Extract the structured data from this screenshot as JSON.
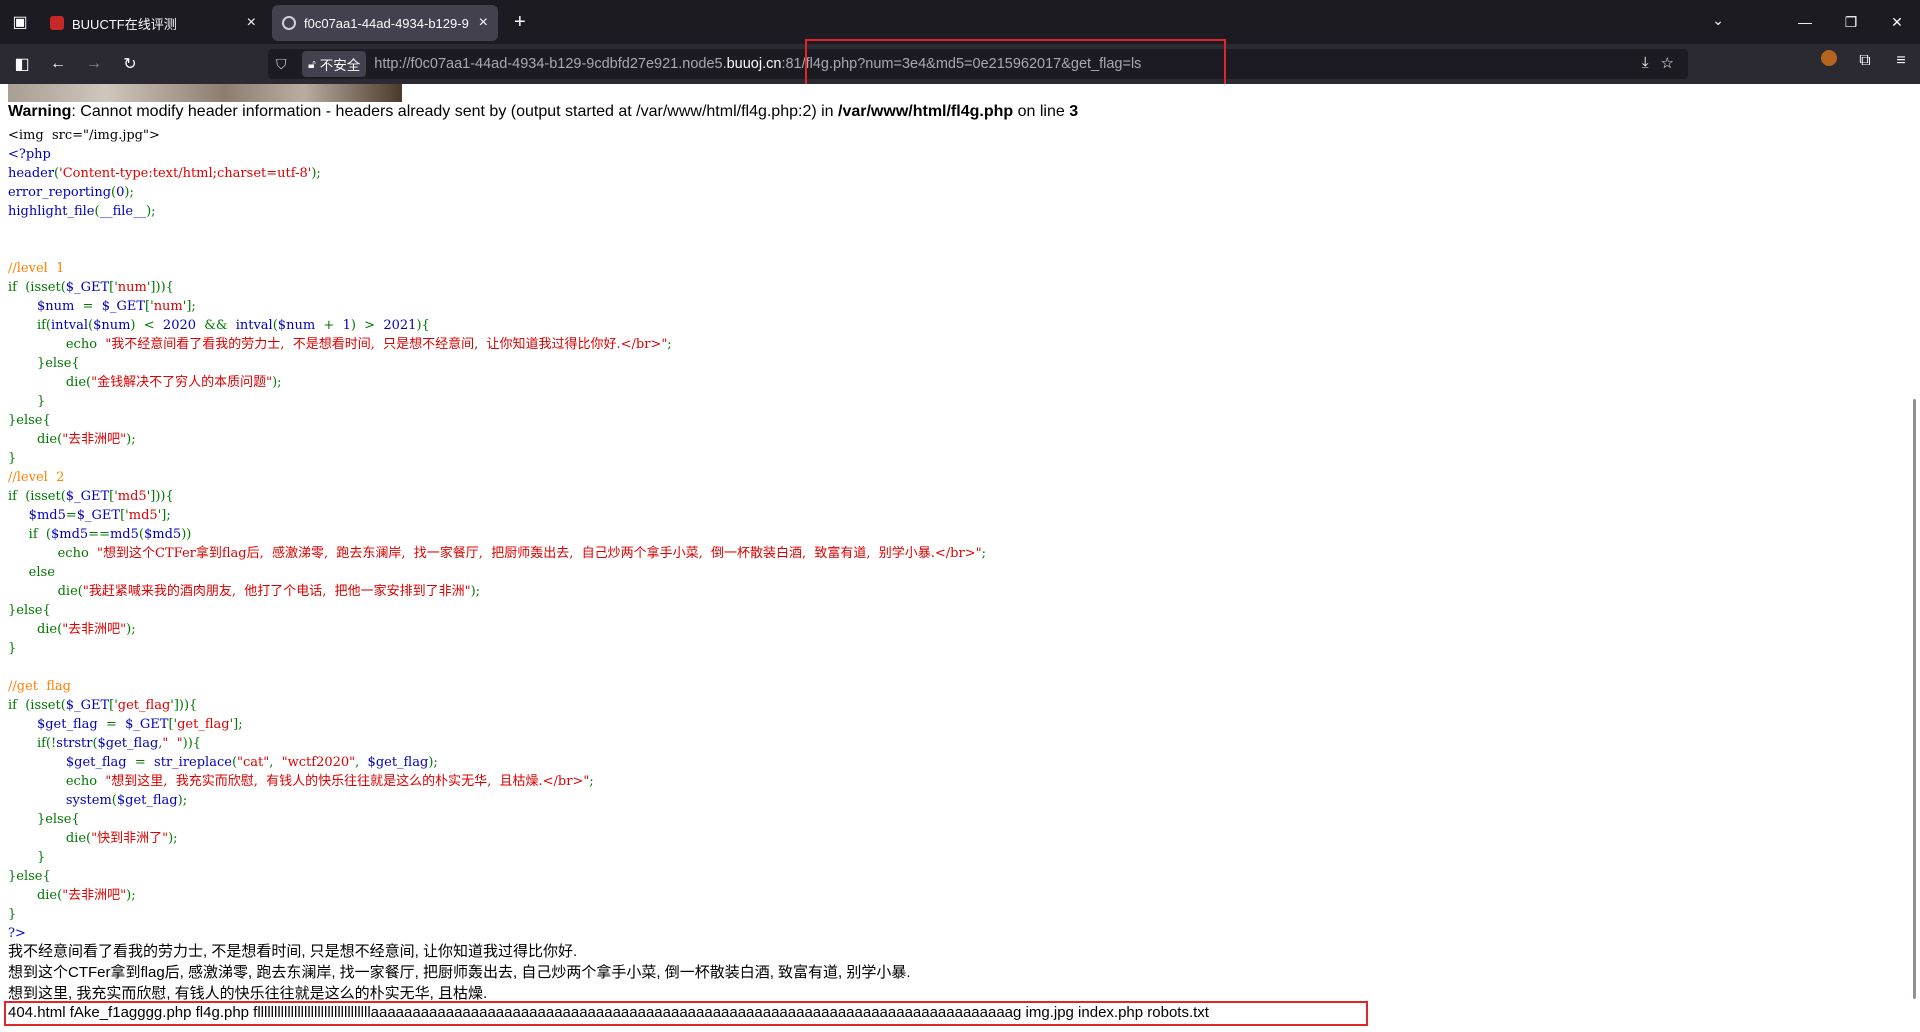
{
  "browser": {
    "tabs": [
      {
        "title": "BUUCTF在线评测",
        "active": false
      },
      {
        "title": "f0c07aa1-44ad-4934-b129-9",
        "active": true
      }
    ],
    "url_dim_prefix": "http://f0c07aa1-44ad-4934-b129-9cdbfd27e921.node5.",
    "url_host": "buuoj.cn",
    "url_rest": ":81/fl4g.php?num=3e4&md5=0e215962017&get_flag=ls",
    "insecure_label": "不安全"
  },
  "page": {
    "warning": {
      "label": "Warning",
      "message": ": Cannot modify header information - headers already sent by (output started at /var/www/html/fl4g.php:2) in ",
      "file": "/var/www/html/fl4g.php",
      "on_line": " on line ",
      "line": "3"
    },
    "code_lines": [
      [
        [
          "#000",
          "<img  src=\"/img.jpg\">"
        ]
      ],
      [
        [
          "#0000bb",
          "<?php"
        ]
      ],
      [
        [
          "#0000bb",
          "header"
        ],
        [
          "#007700",
          "("
        ],
        [
          "#dd0000",
          "'Content-type:text/html;charset=utf-8'"
        ],
        [
          "#007700",
          ");"
        ]
      ],
      [
        [
          "#0000bb",
          "error_reporting"
        ],
        [
          "#007700",
          "("
        ],
        [
          "#0000bb",
          "0"
        ],
        [
          "#007700",
          ");"
        ]
      ],
      [
        [
          "#0000bb",
          "highlight_file"
        ],
        [
          "#007700",
          "("
        ],
        [
          "#0000bb",
          "__file__"
        ],
        [
          "#007700",
          ");"
        ]
      ],
      [],
      [],
      [
        [
          "#ff8000",
          "//level  1"
        ]
      ],
      [
        [
          "#007700",
          "if  (isset("
        ],
        [
          "#0000bb",
          "$_GET"
        ],
        [
          "#007700",
          "['"
        ],
        [
          "#dd0000",
          "num"
        ],
        [
          "#007700",
          "'])){"
        ]
      ],
      [
        [
          "#000",
          "       "
        ],
        [
          "#0000bb",
          "$num"
        ],
        [
          "#007700",
          "  =  "
        ],
        [
          "#0000bb",
          "$_GET"
        ],
        [
          "#007700",
          "['"
        ],
        [
          "#dd0000",
          "num"
        ],
        [
          "#007700",
          "'];"
        ]
      ],
      [
        [
          "#000",
          "       "
        ],
        [
          "#007700",
          "if("
        ],
        [
          "#0000bb",
          "intval"
        ],
        [
          "#007700",
          "("
        ],
        [
          "#0000bb",
          "$num"
        ],
        [
          "#007700",
          ")  <  "
        ],
        [
          "#0000bb",
          "2020"
        ],
        [
          "#007700",
          "  &&  "
        ],
        [
          "#0000bb",
          "intval"
        ],
        [
          "#007700",
          "("
        ],
        [
          "#0000bb",
          "$num"
        ],
        [
          "#007700",
          "  +  "
        ],
        [
          "#0000bb",
          "1"
        ],
        [
          "#007700",
          ")  >  "
        ],
        [
          "#0000bb",
          "2021"
        ],
        [
          "#007700",
          "){"
        ]
      ],
      [
        [
          "#000",
          "              "
        ],
        [
          "#007700",
          "echo  "
        ],
        [
          "#dd0000",
          "\"我不经意间看了看我的劳力士,  不是想看时间,  只是想不经意间,  让你知道我过得比你好.</br>\""
        ],
        [
          "#007700",
          ";"
        ]
      ],
      [
        [
          "#000",
          "       "
        ],
        [
          "#007700",
          "}else{"
        ]
      ],
      [
        [
          "#000",
          "              "
        ],
        [
          "#007700",
          "die("
        ],
        [
          "#dd0000",
          "\"金钱解决不了穷人的本质问题\""
        ],
        [
          "#007700",
          ");"
        ]
      ],
      [
        [
          "#000",
          "       "
        ],
        [
          "#007700",
          "}"
        ]
      ],
      [
        [
          "#007700",
          "}else{"
        ]
      ],
      [
        [
          "#000",
          "       "
        ],
        [
          "#007700",
          "die("
        ],
        [
          "#dd0000",
          "\"去非洲吧\""
        ],
        [
          "#007700",
          ");"
        ]
      ],
      [
        [
          "#007700",
          "}"
        ]
      ],
      [
        [
          "#ff8000",
          "//level  2"
        ]
      ],
      [
        [
          "#007700",
          "if  (isset("
        ],
        [
          "#0000bb",
          "$_GET"
        ],
        [
          "#007700",
          "['"
        ],
        [
          "#dd0000",
          "md5"
        ],
        [
          "#007700",
          "'])){"
        ]
      ],
      [
        [
          "#000",
          "     "
        ],
        [
          "#0000bb",
          "$md5"
        ],
        [
          "#007700",
          "="
        ],
        [
          "#0000bb",
          "$_GET"
        ],
        [
          "#007700",
          "['"
        ],
        [
          "#dd0000",
          "md5"
        ],
        [
          "#007700",
          "'];"
        ]
      ],
      [
        [
          "#000",
          "     "
        ],
        [
          "#007700",
          "if  ("
        ],
        [
          "#0000bb",
          "$md5"
        ],
        [
          "#007700",
          "=="
        ],
        [
          "#0000bb",
          "md5"
        ],
        [
          "#007700",
          "("
        ],
        [
          "#0000bb",
          "$md5"
        ],
        [
          "#007700",
          "))"
        ]
      ],
      [
        [
          "#000",
          "            "
        ],
        [
          "#007700",
          "echo  "
        ],
        [
          "#dd0000",
          "\"想到这个CTFer拿到flag后,  感激涕零,  跑去东澜岸,  找一家餐厅,  把厨师轰出去,  自己炒两个拿手小菜,  倒一杯散装白酒,  致富有道,  别学小暴.</br>\""
        ],
        [
          "#007700",
          ";"
        ]
      ],
      [
        [
          "#000",
          "     "
        ],
        [
          "#007700",
          "else"
        ]
      ],
      [
        [
          "#000",
          "            "
        ],
        [
          "#007700",
          "die("
        ],
        [
          "#dd0000",
          "\"我赶紧喊来我的酒肉朋友,  他打了个电话,  把他一家安排到了非洲\""
        ],
        [
          "#007700",
          ");"
        ]
      ],
      [
        [
          "#007700",
          "}else{"
        ]
      ],
      [
        [
          "#000",
          "       "
        ],
        [
          "#007700",
          "die("
        ],
        [
          "#dd0000",
          "\"去非洲吧\""
        ],
        [
          "#007700",
          ");"
        ]
      ],
      [
        [
          "#007700",
          "}"
        ]
      ],
      [],
      [
        [
          "#ff8000",
          "//get  flag"
        ]
      ],
      [
        [
          "#007700",
          "if  (isset("
        ],
        [
          "#0000bb",
          "$_GET"
        ],
        [
          "#007700",
          "['"
        ],
        [
          "#dd0000",
          "get_flag"
        ],
        [
          "#007700",
          "'])){"
        ]
      ],
      [
        [
          "#000",
          "       "
        ],
        [
          "#0000bb",
          "$get_flag"
        ],
        [
          "#007700",
          "  =  "
        ],
        [
          "#0000bb",
          "$_GET"
        ],
        [
          "#007700",
          "['"
        ],
        [
          "#dd0000",
          "get_flag"
        ],
        [
          "#007700",
          "'];"
        ]
      ],
      [
        [
          "#000",
          "       "
        ],
        [
          "#007700",
          "if(!"
        ],
        [
          "#0000bb",
          "strstr"
        ],
        [
          "#007700",
          "("
        ],
        [
          "#0000bb",
          "$get_flag"
        ],
        [
          "#007700",
          ","
        ],
        [
          "#dd0000",
          "\"  \""
        ],
        [
          "#007700",
          ")){"
        ]
      ],
      [
        [
          "#000",
          "              "
        ],
        [
          "#0000bb",
          "$get_flag"
        ],
        [
          "#007700",
          "  =  "
        ],
        [
          "#0000bb",
          "str_ireplace"
        ],
        [
          "#007700",
          "("
        ],
        [
          "#dd0000",
          "\"cat\""
        ],
        [
          "#007700",
          ",  "
        ],
        [
          "#dd0000",
          "\"wctf2020\""
        ],
        [
          "#007700",
          ",  "
        ],
        [
          "#0000bb",
          "$get_flag"
        ],
        [
          "#007700",
          ");"
        ]
      ],
      [
        [
          "#000",
          "              "
        ],
        [
          "#007700",
          "echo  "
        ],
        [
          "#dd0000",
          "\"想到这里,  我充实而欣慰,  有钱人的快乐往往就是这么的朴实无华,  且枯燥.</br>\""
        ],
        [
          "#007700",
          ";"
        ]
      ],
      [
        [
          "#000",
          "              "
        ],
        [
          "#0000bb",
          "system"
        ],
        [
          "#007700",
          "("
        ],
        [
          "#0000bb",
          "$get_flag"
        ],
        [
          "#007700",
          ");"
        ]
      ],
      [
        [
          "#000",
          "       "
        ],
        [
          "#007700",
          "}else{"
        ]
      ],
      [
        [
          "#000",
          "              "
        ],
        [
          "#007700",
          "die("
        ],
        [
          "#dd0000",
          "\"快到非洲了\""
        ],
        [
          "#007700",
          ");"
        ]
      ],
      [
        [
          "#000",
          "       "
        ],
        [
          "#007700",
          "}"
        ]
      ],
      [
        [
          "#007700",
          "}else{"
        ]
      ],
      [
        [
          "#000",
          "       "
        ],
        [
          "#007700",
          "die("
        ],
        [
          "#dd0000",
          "\"去非洲吧\""
        ],
        [
          "#007700",
          ");"
        ]
      ],
      [
        [
          "#007700",
          "}"
        ]
      ],
      [
        [
          "#0000bb",
          "?>"
        ]
      ]
    ],
    "output_lines": [
      "我不经意间看了看我的劳力士, 不是想看时间, 只是想不经意间, 让你知道我过得比你好.",
      "想到这个CTFer拿到flag后, 感激涕零, 跑去东澜岸, 找一家餐厅, 把厨师轰出去, 自己炒两个拿手小菜, 倒一杯散装白酒, 致富有道, 别学小暴.",
      "想到这里, 我充实而欣慰, 有钱人的快乐往往就是这么的朴实无华, 且枯燥."
    ],
    "ls_output": "404.html fAke_f1agggg.php fl4g.php fllllllllllllllllllllllllllllllllllaaaaaaaaaaaaaaaaaaaaaaaaaaaaaaaaaaaaaaaaaaaaaaaaaaaaaaaaaaaaaaaaaaaaaaaaaaaaag img.jpg index.php robots.txt"
  },
  "colors": {
    "keyword": "#007700",
    "variable": "#0000bb",
    "string": "#dd0000",
    "comment": "#ff8000",
    "highlight_box": "#e0262b"
  }
}
